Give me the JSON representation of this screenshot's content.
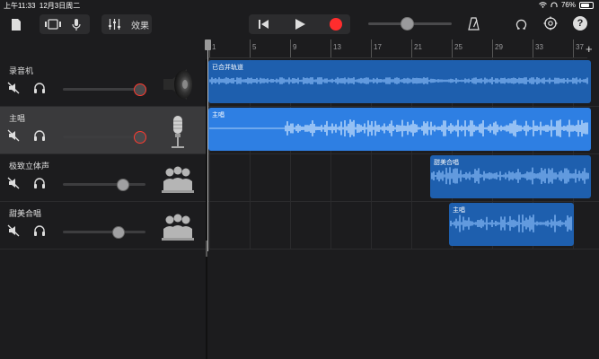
{
  "status": {
    "time": "上午11:33",
    "date": "12月3日周二",
    "battery": "76%"
  },
  "toolbar": {
    "fx_label": "效果"
  },
  "ruler": {
    "bars": [
      "1",
      "5",
      "9",
      "13",
      "17",
      "21",
      "25",
      "29",
      "33",
      "37"
    ]
  },
  "tracks": [
    {
      "name": "录音机",
      "instrument": "speaker-icon",
      "volume": 0.92,
      "muted_style": "red",
      "selected": false
    },
    {
      "name": "主唱",
      "instrument": "microphone-icon",
      "volume": 0.92,
      "muted_style": "red",
      "selected": true
    },
    {
      "name": "极致立体声",
      "instrument": "choir-icon",
      "volume": 0.72,
      "muted_style": "grey",
      "selected": false
    },
    {
      "name": "甜美合唱",
      "instrument": "choir-icon",
      "volume": 0.66,
      "muted_style": "grey",
      "selected": false
    }
  ],
  "regions": [
    {
      "label": "已合并轨道",
      "color": "#1e5fae",
      "wave": "#8fc2ff",
      "start": 0.0,
      "end": 1.0
    },
    {
      "label": "主唱",
      "color": "#2e7fe3",
      "wave": "#d9ecff",
      "start": 0.0,
      "end": 1.0
    },
    {
      "label": "甜美合唱",
      "color": "#1e5fae",
      "wave": "#8fc2ff",
      "start": 0.577,
      "end": 1.0
    },
    {
      "label": "主唱",
      "color": "#1e5fae",
      "wave": "#8fc2ff",
      "start": 0.627,
      "end": 0.957
    }
  ],
  "colors": {
    "accent": "#2e7fe3",
    "record": "#ff2d2d"
  }
}
